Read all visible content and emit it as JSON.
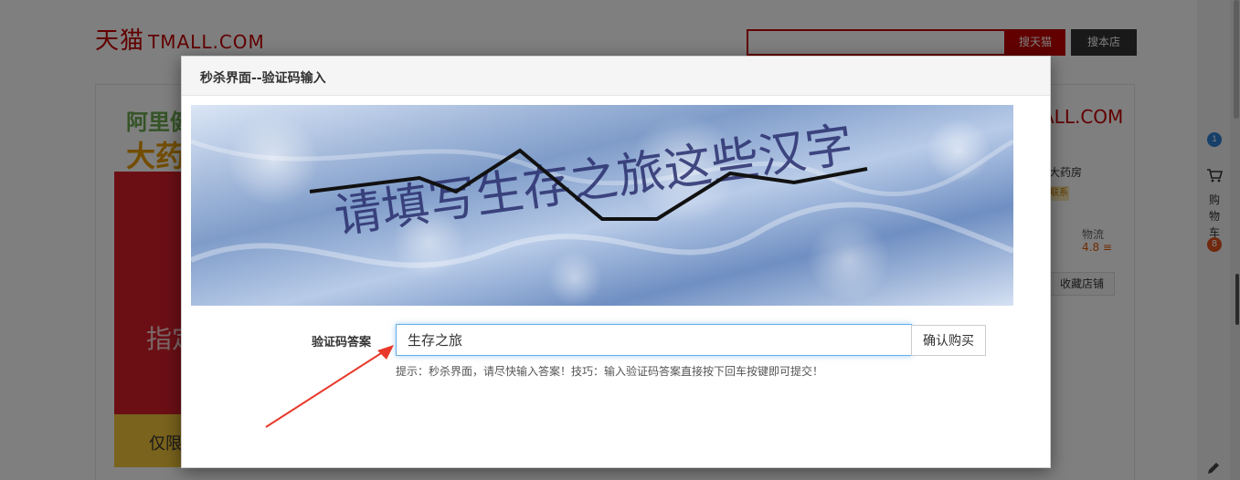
{
  "background": {
    "logo_cn": "天猫",
    "logo_latin": "TMALL.COM",
    "search_tmall_label": "搜天猫",
    "search_shop_label": "搜本店",
    "store_brand_line1": "阿里健",
    "store_brand_line2": "大药",
    "promo_banner_text": "指定",
    "promo_strip_text": "仅限",
    "right_logo": "ALL.COM",
    "right_store_name": "大药房",
    "right_badge": "联系",
    "logistics_label": "物流",
    "logistics_score": "4.8 ≡",
    "favorite_store_label": "收藏店铺",
    "side_count": "1",
    "side_cart_label": "购物车",
    "side_cart_count": "8"
  },
  "modal": {
    "title": "秒杀界面--验证码输入",
    "captcha_text": "请填写生存之旅这些汉字",
    "answer_label": "验证码答案",
    "answer_value": "生存之旅",
    "confirm_label": "确认购买",
    "hint": "提示：秒杀界面，请尽快输入答案！技巧：输入验证码答案直接按下回车按键即可提交！"
  },
  "colors": {
    "brand_red": "#c40000",
    "overlay": "rgba(0,0,0,0.5)",
    "input_focus": "#66afe9",
    "arrow": "#e8392b"
  }
}
